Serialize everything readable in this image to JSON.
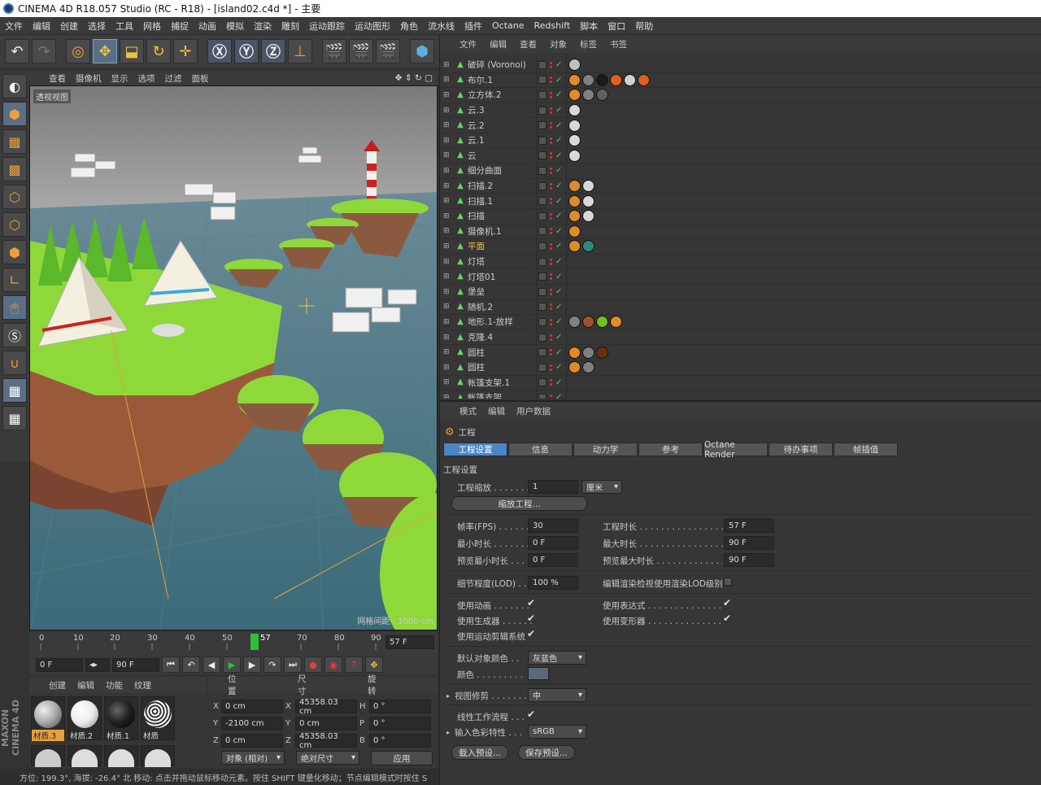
{
  "window": {
    "title": "CINEMA 4D R18.057 Studio (RC - R18) - [island02.c4d *] - 主要"
  },
  "menu": [
    "文件",
    "编辑",
    "创建",
    "选择",
    "工具",
    "网格",
    "捕捉",
    "动画",
    "模拟",
    "渲染",
    "雕刻",
    "运动跟踪",
    "运动图形",
    "角色",
    "流水线",
    "插件",
    "Octane",
    "Redshift",
    "脚本",
    "窗口",
    "帮助"
  ],
  "viewport": {
    "menu": [
      "查看",
      "摄像机",
      "显示",
      "选项",
      "过滤",
      "面板"
    ],
    "label": "透视视图",
    "grid_info": "网格间距 : 1000 cm"
  },
  "timeline": {
    "ticks": [
      "0",
      "10",
      "20",
      "30",
      "40",
      "50",
      "57",
      "70",
      "80",
      "90"
    ],
    "current_frame": 57,
    "current_label": "57",
    "end_label": "57 F",
    "start_field": "0 F",
    "end_field": "90 F"
  },
  "materials": {
    "menu": [
      "创建",
      "编辑",
      "功能",
      "纹理"
    ],
    "items": [
      {
        "label": "材质.3",
        "color": "#a8a8a8",
        "selected": true
      },
      {
        "label": "材质.2",
        "color": "#ececec",
        "selected": false
      },
      {
        "label": "材质.1",
        "color": "#202020",
        "selected": false
      },
      {
        "label": "材质",
        "color": "#909090",
        "selected": false
      }
    ]
  },
  "coords": {
    "headers": [
      "位置",
      "尺寸",
      "旋转"
    ],
    "rows": [
      {
        "axis": "X",
        "pos": "0 cm",
        "size": "45358.03 cm",
        "rot_axis": "H",
        "rot": "0 °"
      },
      {
        "axis": "Y",
        "pos": "-2100 cm",
        "size": "0 cm",
        "rot_axis": "P",
        "rot": "0 °"
      },
      {
        "axis": "Z",
        "pos": "0 cm",
        "size": "45358.03 cm",
        "rot_axis": "B",
        "rot": "0 °"
      }
    ],
    "mode": "对象 (相对)",
    "size_mode": "绝对尺寸",
    "apply": "应用"
  },
  "status": "方位: 199.3°, 海拔: -26.4° 北    移动: 点击并拖动鼠标移动元素。按住 SHIFT 键量化移动；节点编辑模式时按住 S",
  "brand": "MAXON CINEMA 4D",
  "objects": {
    "menu": [
      "文件",
      "编辑",
      "查看",
      "对象",
      "标签",
      "书签"
    ],
    "items": [
      {
        "name": "破碎 (Voronoi)",
        "highlight": false,
        "tags": [
          "#c0c0c0"
        ]
      },
      {
        "name": "布尔.1",
        "highlight": false,
        "tags": [
          "#e08a2a",
          "#808080",
          "#1a1a1a",
          "#e06020",
          "#d0d0d0",
          "#e06020"
        ]
      },
      {
        "name": "立方体.2",
        "highlight": false,
        "tags": [
          "#e08a2a",
          "#808080",
          "#606060"
        ]
      },
      {
        "name": "云.3",
        "highlight": false,
        "tags": [
          "#d8d8d8"
        ]
      },
      {
        "name": "云.2",
        "highlight": false,
        "tags": [
          "#d8d8d8"
        ]
      },
      {
        "name": "云.1",
        "highlight": false,
        "tags": [
          "#d8d8d8"
        ]
      },
      {
        "name": "云",
        "highlight": false,
        "tags": [
          "#d8d8d8"
        ]
      },
      {
        "name": "细分曲面",
        "highlight": false,
        "tags": []
      },
      {
        "name": "扫描.2",
        "highlight": false,
        "tags": [
          "#e08a2a",
          "#d8d8d8"
        ]
      },
      {
        "name": "扫描.1",
        "highlight": false,
        "tags": [
          "#e08a2a",
          "#d8d8d8"
        ]
      },
      {
        "name": "扫描",
        "highlight": false,
        "tags": [
          "#e08a2a",
          "#d8d8d8"
        ]
      },
      {
        "name": "摄像机.1",
        "highlight": false,
        "tags": [
          "#e08a2a"
        ]
      },
      {
        "name": "平面",
        "highlight": true,
        "tags": [
          "#e08a2a",
          "#2a8a80"
        ]
      },
      {
        "name": "灯塔",
        "highlight": false,
        "tags": []
      },
      {
        "name": "灯塔01",
        "highlight": false,
        "tags": []
      },
      {
        "name": "堡垒",
        "highlight": false,
        "tags": []
      },
      {
        "name": "随机.2",
        "highlight": false,
        "tags": []
      },
      {
        "name": "地形.1-放样",
        "highlight": false,
        "tags": [
          "#808080",
          "#a05030",
          "#70c020",
          "#e08a2a"
        ]
      },
      {
        "name": "克隆.4",
        "highlight": false,
        "tags": []
      },
      {
        "name": "圆柱",
        "highlight": false,
        "tags": [
          "#e08a2a",
          "#808080",
          "#6a3010"
        ]
      },
      {
        "name": "圆柱",
        "highlight": false,
        "tags": [
          "#e08a2a",
          "#808080"
        ]
      },
      {
        "name": "帐篷支架.1",
        "highlight": false,
        "tags": []
      },
      {
        "name": "帐篷支架",
        "highlight": false,
        "tags": []
      }
    ]
  },
  "attributes": {
    "menu": [
      "模式",
      "编辑",
      "用户数据"
    ],
    "object_title": "工程",
    "tabs": [
      "工程设置",
      "信息",
      "动力学",
      "参考",
      "Octane Render",
      "待办事项",
      "帧插值"
    ],
    "section": "工程设置",
    "scale_label": "工程缩放 . . . . . . . .",
    "scale_value": "1",
    "scale_unit": "厘米",
    "scale_button": "缩放工程...",
    "fps_label": "帧率(FPS) . . . . . .",
    "fps": "30",
    "min_label": "最小时长 . . . . . . .",
    "min": "0 F",
    "prev_min_label": "预览最小时长 . . . . .",
    "prev_min": "0 F",
    "proj_label": "工程时长 . . . . . . . . . . . . . . . . . .",
    "proj": "57 F",
    "max_label": "最大时长 . . . . . . . . . . . . . . . . . .",
    "max": "90 F",
    "prev_max_label": "预览最大时长 . . . . . . . . . . . . . . . .",
    "prev_max": "90 F",
    "lod_label": "细节程度(LOD) . . .",
    "lod": "100 %",
    "lod_render_label": "编辑渲染检视使用渲染LOD级别",
    "use_anim_label": "使用动画 . . . . . . .",
    "use_gen_label": "使用生成器 . . . . . .",
    "use_motion_label": "使用运动剪辑系统",
    "use_expr_label": "使用表达式 . . . . . . . . . . . . . . . .",
    "use_deform_label": "使用变形器 . . . . . . . . . . . . . . . .",
    "default_color_label": "默认对象颜色 . .",
    "default_color": "灰蓝色",
    "color_label": "颜色 . . . . . . . . .",
    "color_value": "#5a6878",
    "clip_label": "视图修剪 . . . . . . . .",
    "clip": "中",
    "linear_label": "线性工作流程 . . .",
    "profile_label": "输入色彩特性 . . .",
    "profile": "sRGB",
    "load_preset": "载入预设...",
    "save_preset": "保存预设..."
  }
}
